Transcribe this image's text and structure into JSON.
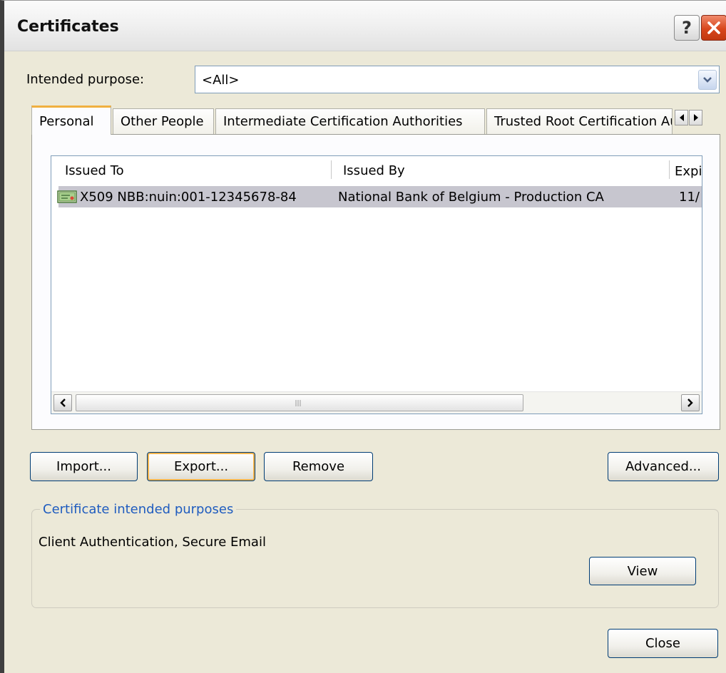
{
  "window": {
    "title": "Certificates",
    "help_button": "?",
    "close_icon": "close-x-icon"
  },
  "purpose": {
    "label": "Intended purpose:",
    "value": "<All>"
  },
  "tabs": [
    {
      "label": "Personal",
      "active": true
    },
    {
      "label": "Other People",
      "active": false
    },
    {
      "label": "Intermediate Certification Authorities",
      "active": false
    },
    {
      "label": "Trusted Root Certification Authorities",
      "active": false
    }
  ],
  "list": {
    "columns": [
      "Issued To",
      "Issued By",
      "Expiration Date"
    ],
    "rows": [
      {
        "issued_to": "X509 NBB:nuin:001-12345678-84",
        "issued_by": "National Bank of Belgium - Production CA",
        "expiration": "11/",
        "icon": "certificate-icon",
        "selected": true
      }
    ]
  },
  "buttons": {
    "import": "Import...",
    "export": "Export...",
    "remove": "Remove",
    "advanced": "Advanced...",
    "view": "View",
    "close": "Close"
  },
  "purposes_group": {
    "legend": "Certificate intended purposes",
    "text": "Client Authentication, Secure Email"
  },
  "colors": {
    "dialog_bg": "#ece9d8",
    "selection": "#c7c6cf",
    "group_legend": "#1f5cbf",
    "close_button": "#d8461c",
    "active_tab_accent": "#f0b040"
  }
}
